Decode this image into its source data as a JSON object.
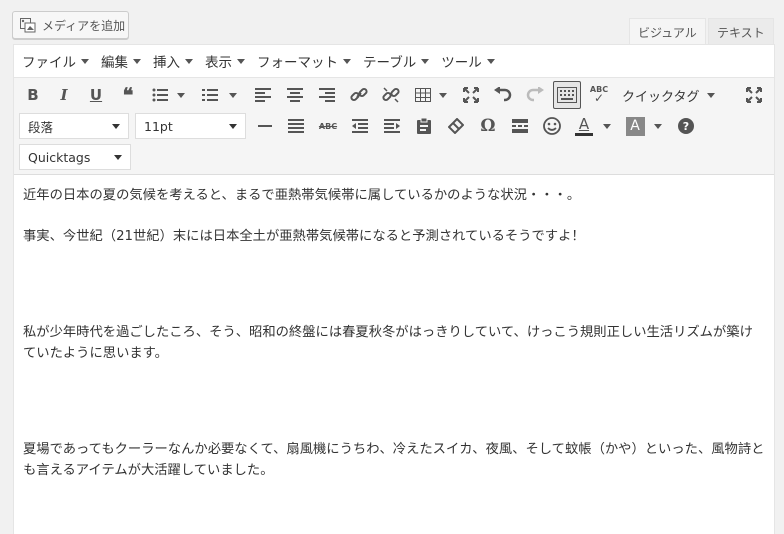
{
  "add_media": {
    "label": "メディアを追加",
    "icon": "media-icon"
  },
  "mode_tabs": {
    "visual": "ビジュアル",
    "text": "テキスト"
  },
  "menu": [
    {
      "label": "ファイル"
    },
    {
      "label": "編集"
    },
    {
      "label": "挿入"
    },
    {
      "label": "表示"
    },
    {
      "label": "フォーマット"
    },
    {
      "label": "テーブル"
    },
    {
      "label": "ツール"
    }
  ],
  "toolbar": {
    "quicktag_label": "クイックタグ",
    "format_select": "段落",
    "size_select": "11pt",
    "quicktags_select": "Quicktags",
    "bold_glyph": "B",
    "italic_glyph": "I",
    "underline_glyph": "U",
    "quote_glyph": "❝",
    "omega_glyph": "Ω",
    "help_glyph": "?",
    "text_color_glyph": "A",
    "bg_color_glyph": "A",
    "abc_glyph": "ABC",
    "colors": {
      "text_color_bar": "#333333",
      "bg_color_box": "#888888"
    }
  },
  "content": {
    "p1": "近年の日本の夏の気候を考えると、まるで亜熱帯気候帯に属しているかのような状況・・・。",
    "p2": "事実、今世紀（21世紀）末には日本全土が亜熱帯気候帯になると予測されているそうですよ！",
    "p3": "私が少年時代を過ごしたころ、そう、昭和の終盤には春夏秋冬がはっきりしていて、けっこう規則正しい生活リズムが築けていたように思います。",
    "p4": "夏場であってもクーラーなんか必要なくて、扇風機にうちわ、冷えたスイカ、夜風、そして蚊帳（かや）といった、風物詩とも言えるアイテムが大活躍していました。"
  }
}
